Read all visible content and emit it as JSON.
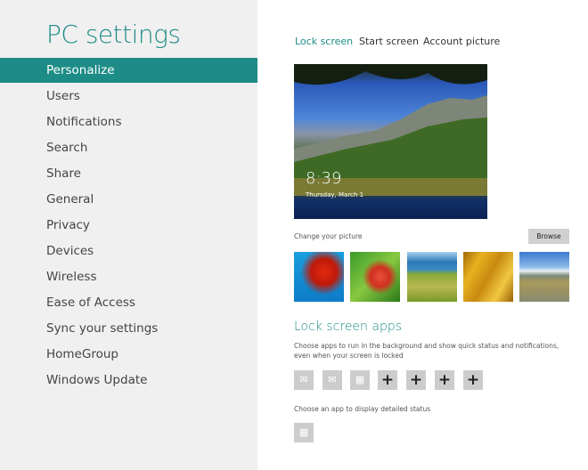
{
  "sidebar": {
    "title": "PC settings",
    "items": [
      "Personalize",
      "Users",
      "Notifications",
      "Search",
      "Share",
      "General",
      "Privacy",
      "Devices",
      "Wireless",
      "Ease of Access",
      "Sync your settings",
      "HomeGroup",
      "Windows Update"
    ],
    "selected": "Personalize"
  },
  "tabs": [
    "Lock screen",
    "Start screen",
    "Account picture"
  ],
  "preview": {
    "time": "8:39",
    "date": "Thursday, March 1"
  },
  "change_picture": {
    "label": "Change your picture",
    "browse": "Browse"
  },
  "lock_apps": {
    "heading": "Lock screen apps",
    "description": "Choose apps to run in the background and show quick status and notifications, even when your screen is locked",
    "detailed_label": "Choose an app to display detailed status",
    "apps": [
      "messaging-icon",
      "mail-icon",
      "calendar-icon",
      "+",
      "+",
      "+",
      "+"
    ],
    "detailed_app": "calendar-icon"
  },
  "colors": {
    "accent": "#1e8c86"
  }
}
